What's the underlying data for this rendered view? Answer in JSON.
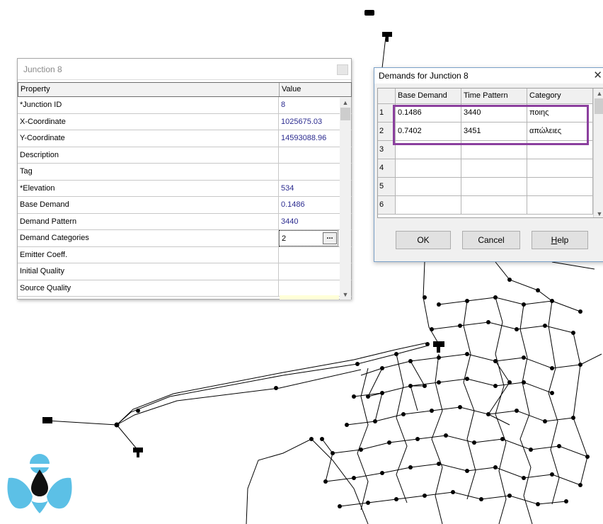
{
  "property_editor": {
    "title": "Junction 8",
    "columns": {
      "property": "Property",
      "value": "Value"
    },
    "rows": [
      {
        "name": "*Junction ID",
        "value": "8"
      },
      {
        "name": "X-Coordinate",
        "value": "1025675.03"
      },
      {
        "name": "Y-Coordinate",
        "value": "14593088.96"
      },
      {
        "name": "Description",
        "value": ""
      },
      {
        "name": "Tag",
        "value": ""
      },
      {
        "name": "*Elevation",
        "value": "534"
      },
      {
        "name": "Base Demand",
        "value": "0.1486"
      },
      {
        "name": "Demand Pattern",
        "value": "3440"
      },
      {
        "name": "Demand Categories",
        "value": "2"
      },
      {
        "name": "Emitter Coeff.",
        "value": ""
      },
      {
        "name": "Initial Quality",
        "value": ""
      },
      {
        "name": "Source Quality",
        "value": ""
      }
    ],
    "ellipsis_label": "..."
  },
  "demands_dialog": {
    "title": "Demands for Junction 8",
    "close_glyph": "✕",
    "columns": [
      "Base Demand",
      "Time Pattern",
      "Category"
    ],
    "rows": [
      {
        "num": "1",
        "base": "0.1486",
        "pattern": "3440",
        "category": "ποιης"
      },
      {
        "num": "2",
        "base": "0.7402",
        "pattern": "3451",
        "category": "απώλειες"
      },
      {
        "num": "3",
        "base": "",
        "pattern": "",
        "category": ""
      },
      {
        "num": "4",
        "base": "",
        "pattern": "",
        "category": ""
      },
      {
        "num": "5",
        "base": "",
        "pattern": "",
        "category": ""
      },
      {
        "num": "6",
        "base": "",
        "pattern": "",
        "category": ""
      }
    ],
    "buttons": {
      "ok": "OK",
      "cancel": "Cancel",
      "help_prefix": "",
      "help_underlined": "H",
      "help_rest": "elp"
    }
  },
  "colors": {
    "highlight": "#8b3f9e",
    "logo_blue": "#5cc0e6",
    "network": "#000000"
  },
  "icons": [
    "reservoir-icon",
    "tank-icon",
    "logo-drop-icon",
    "scroll-up-icon",
    "scroll-down-icon"
  ]
}
